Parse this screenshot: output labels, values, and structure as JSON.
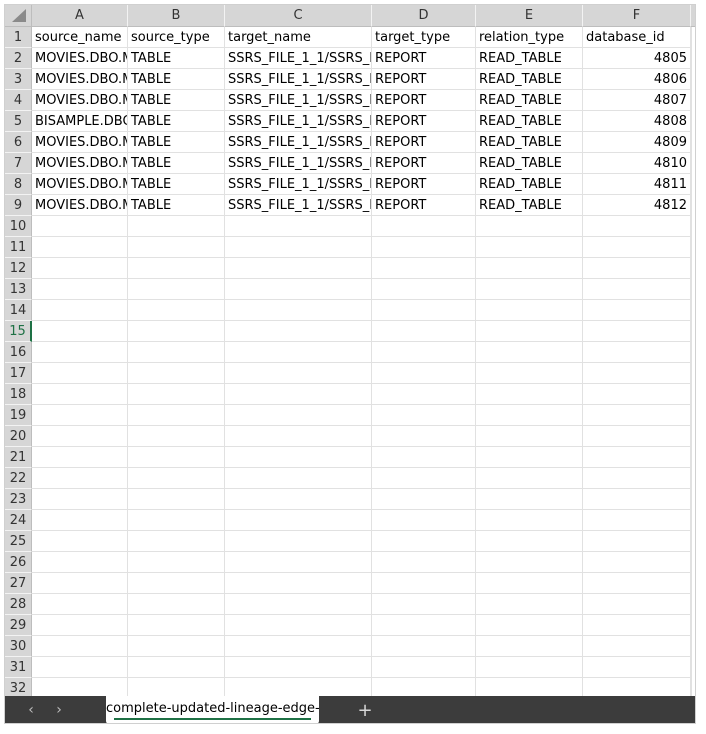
{
  "columns": [
    "A",
    "B",
    "C",
    "D",
    "E",
    "F"
  ],
  "rows": [
    {
      "num": "1",
      "cells": [
        "source_name",
        "source_type",
        "target_name",
        "target_type",
        "relation_type",
        "database_id"
      ]
    },
    {
      "num": "2",
      "cells": [
        "MOVIES.DBO.M",
        "TABLE",
        "SSRS_FILE_1_1/SSRS_F",
        "REPORT",
        "READ_TABLE",
        "4805"
      ]
    },
    {
      "num": "3",
      "cells": [
        "MOVIES.DBO.M",
        "TABLE",
        "SSRS_FILE_1_1/SSRS_F",
        "REPORT",
        "READ_TABLE",
        "4806"
      ]
    },
    {
      "num": "4",
      "cells": [
        "MOVIES.DBO.M",
        "TABLE",
        "SSRS_FILE_1_1/SSRS_F",
        "REPORT",
        "READ_TABLE",
        "4807"
      ]
    },
    {
      "num": "5",
      "cells": [
        "BISAMPLE.DBO",
        "TABLE",
        "SSRS_FILE_1_1/SSRS_F",
        "REPORT",
        "READ_TABLE",
        "4808"
      ]
    },
    {
      "num": "6",
      "cells": [
        "MOVIES.DBO.M",
        "TABLE",
        "SSRS_FILE_1_1/SSRS_F",
        "REPORT",
        "READ_TABLE",
        "4809"
      ]
    },
    {
      "num": "7",
      "cells": [
        "MOVIES.DBO.M",
        "TABLE",
        "SSRS_FILE_1_1/SSRS_F",
        "REPORT",
        "READ_TABLE",
        "4810"
      ]
    },
    {
      "num": "8",
      "cells": [
        "MOVIES.DBO.M",
        "TABLE",
        "SSRS_FILE_1_1/SSRS_F",
        "REPORT",
        "READ_TABLE",
        "4811"
      ]
    },
    {
      "num": "9",
      "cells": [
        "MOVIES.DBO.M",
        "TABLE",
        "SSRS_FILE_1_1/SSRS_F",
        "REPORT",
        "READ_TABLE",
        "4812"
      ]
    },
    {
      "num": "10",
      "cells": [
        "",
        "",
        "",
        "",
        "",
        ""
      ]
    },
    {
      "num": "11",
      "cells": [
        "",
        "",
        "",
        "",
        "",
        ""
      ]
    },
    {
      "num": "12",
      "cells": [
        "",
        "",
        "",
        "",
        "",
        ""
      ]
    },
    {
      "num": "13",
      "cells": [
        "",
        "",
        "",
        "",
        "",
        ""
      ]
    },
    {
      "num": "14",
      "cells": [
        "",
        "",
        "",
        "",
        "",
        ""
      ]
    },
    {
      "num": "15",
      "cells": [
        "",
        "",
        "",
        "",
        "",
        ""
      ]
    },
    {
      "num": "16",
      "cells": [
        "",
        "",
        "",
        "",
        "",
        ""
      ]
    },
    {
      "num": "17",
      "cells": [
        "",
        "",
        "",
        "",
        "",
        ""
      ]
    },
    {
      "num": "18",
      "cells": [
        "",
        "",
        "",
        "",
        "",
        ""
      ]
    },
    {
      "num": "19",
      "cells": [
        "",
        "",
        "",
        "",
        "",
        ""
      ]
    },
    {
      "num": "20",
      "cells": [
        "",
        "",
        "",
        "",
        "",
        ""
      ]
    },
    {
      "num": "21",
      "cells": [
        "",
        "",
        "",
        "",
        "",
        ""
      ]
    },
    {
      "num": "22",
      "cells": [
        "",
        "",
        "",
        "",
        "",
        ""
      ]
    },
    {
      "num": "23",
      "cells": [
        "",
        "",
        "",
        "",
        "",
        ""
      ]
    },
    {
      "num": "24",
      "cells": [
        "",
        "",
        "",
        "",
        "",
        ""
      ]
    },
    {
      "num": "25",
      "cells": [
        "",
        "",
        "",
        "",
        "",
        ""
      ]
    },
    {
      "num": "26",
      "cells": [
        "",
        "",
        "",
        "",
        "",
        ""
      ]
    },
    {
      "num": "27",
      "cells": [
        "",
        "",
        "",
        "",
        "",
        ""
      ]
    },
    {
      "num": "28",
      "cells": [
        "",
        "",
        "",
        "",
        "",
        ""
      ]
    },
    {
      "num": "29",
      "cells": [
        "",
        "",
        "",
        "",
        "",
        ""
      ]
    },
    {
      "num": "30",
      "cells": [
        "",
        "",
        "",
        "",
        "",
        ""
      ]
    },
    {
      "num": "31",
      "cells": [
        "",
        "",
        "",
        "",
        "",
        ""
      ]
    },
    {
      "num": "32",
      "cells": [
        "",
        "",
        "",
        "",
        "",
        ""
      ]
    }
  ],
  "active_row": "15",
  "sheet_tab": {
    "label": "complete-updated-lineage-edge-l"
  },
  "icons": {
    "prev": "chevron-left-icon",
    "next": "chevron-right-icon",
    "add": "plus-icon",
    "select_all": "select-all-triangle-icon"
  },
  "colors": {
    "header_bg": "#d6d6d6",
    "gridline": "#e1e1e1",
    "tabbar_bg": "#3c3c3c",
    "accent": "#1e7145"
  }
}
